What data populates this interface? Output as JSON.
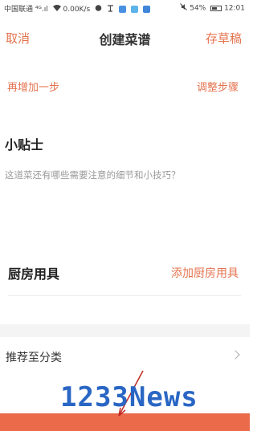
{
  "status_bar": {
    "carrier": "中国联通",
    "signal": "⁴ᴳ.ıl",
    "speed": "0.00K/s",
    "battery": "54%",
    "time": "12:01",
    "app_icon_colors": [
      "#4a90e2",
      "#5bb3ea",
      "#3f86d8"
    ]
  },
  "nav": {
    "cancel": "取消",
    "title": "创建菜谱",
    "save_draft": "存草稿"
  },
  "steps": {
    "add_step": "再增加一步",
    "adjust_steps": "调整步骤"
  },
  "tips": {
    "title": "小贴士",
    "placeholder": "这道菜还有哪些需要注意的细节和小技巧？"
  },
  "utensils": {
    "title": "厨房用具",
    "add": "添加厨房用具"
  },
  "category": {
    "label": "推荐至分类"
  },
  "watermark": {
    "text": "1233News"
  },
  "colors": {
    "accent": "#e4734f",
    "bottom_bar": "#ea6a4a"
  }
}
